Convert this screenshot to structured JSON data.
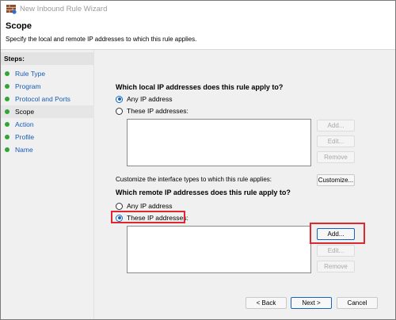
{
  "window": {
    "title": "New Inbound Rule Wizard"
  },
  "header": {
    "title": "Scope",
    "description": "Specify the local and remote IP addresses to which this rule applies."
  },
  "sidebar": {
    "heading": "Steps:",
    "items": [
      {
        "label": "Rule Type"
      },
      {
        "label": "Program"
      },
      {
        "label": "Protocol and Ports"
      },
      {
        "label": "Scope"
      },
      {
        "label": "Action"
      },
      {
        "label": "Profile"
      },
      {
        "label": "Name"
      }
    ],
    "active_index": 3
  },
  "local": {
    "question": "Which local IP addresses does this rule apply to?",
    "option_any": "Any IP address",
    "option_these": "These IP addresses:",
    "selected": "any",
    "buttons": {
      "add": "Add...",
      "edit": "Edit...",
      "remove": "Remove"
    }
  },
  "interface": {
    "text": "Customize the interface types to which this rule applies:",
    "button": "Customize..."
  },
  "remote": {
    "question": "Which remote IP addresses does this rule apply to?",
    "option_any": "Any IP address",
    "option_these": "These IP addresses:",
    "selected": "these",
    "buttons": {
      "add": "Add...",
      "edit": "Edit...",
      "remove": "Remove"
    }
  },
  "footer": {
    "back": "< Back",
    "next": "Next >",
    "cancel": "Cancel"
  },
  "colors": {
    "highlight": "#e0262e",
    "step_dot": "#31a537",
    "link_blue": "#1a5bb5",
    "accent": "#1565c0"
  }
}
